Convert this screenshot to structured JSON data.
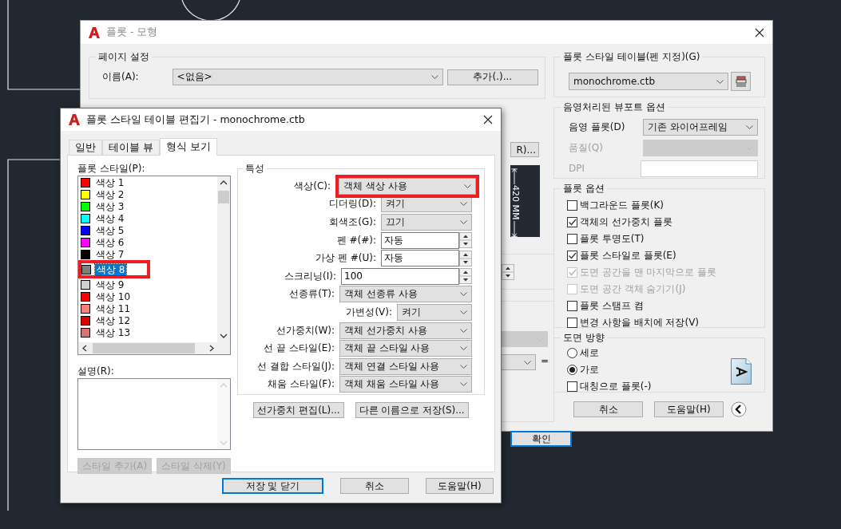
{
  "plot_dialog": {
    "title": "플롯 - 모형",
    "page_setup": {
      "title": "페이지 설정",
      "name_label": "이름(A):",
      "name_value": "<없음>",
      "add_button": "추가(.)..."
    },
    "covered": {
      "properties_button": "R)...",
      "paper_size": "420 MM",
      "equals": "=",
      "confirm_button": {
        "label": "확인",
        "default": true
      }
    },
    "plot_style_table": {
      "title": "플롯 스타일 테이블(펜 지정)(G)",
      "value": "monochrome.ctb"
    },
    "shaded_viewport": {
      "title": "음영처리된 뷰포트 옵션",
      "fields": [
        {
          "label": "음영 플롯(D)",
          "value": "기존 와이어프레임",
          "kind": "select",
          "disabled": false
        },
        {
          "label": "품질(Q)",
          "kind": "select",
          "disabled": true
        },
        {
          "label": "DPI",
          "kind": "input",
          "disabled": true
        }
      ]
    },
    "plot_options": {
      "title": "플롯 옵션",
      "items": [
        {
          "label": "백그라운드 플롯(K)",
          "checked": false,
          "disabled": false
        },
        {
          "label": "객체의 선가중치 플롯",
          "checked": true,
          "disabled": false
        },
        {
          "label": "플롯 투명도(T)",
          "checked": false,
          "disabled": false
        },
        {
          "label": "플롯 스타일로 플롯(E)",
          "checked": true,
          "disabled": false
        },
        {
          "label": "도면 공간을 맨 마지막으로 플롯",
          "checked": true,
          "disabled": true
        },
        {
          "label": "도면 공간 객체 숨기기(J)",
          "checked": false,
          "disabled": true
        },
        {
          "label": "플롯 스탬프 켬",
          "checked": false,
          "disabled": false
        },
        {
          "label": "변경 사항을 배치에 저장(V)",
          "checked": false,
          "disabled": false
        }
      ]
    },
    "orientation": {
      "title": "도면 방향",
      "options": [
        {
          "label": "세로",
          "selected": false
        },
        {
          "label": "가로",
          "selected": true
        }
      ],
      "mirror": {
        "label": "대칭으로 플롯(-)",
        "checked": false
      }
    },
    "buttons": [
      {
        "label": "취소",
        "default": false
      },
      {
        "label": "도움말(H)",
        "default": false
      }
    ]
  },
  "editor": {
    "title": "플롯 스타일 테이블 편집기 - monochrome.ctb",
    "tabs": [
      {
        "label": "일반",
        "selected": false
      },
      {
        "label": "테이블 뷰",
        "selected": false
      },
      {
        "label": "형식 보기",
        "selected": true
      }
    ],
    "styles_label": "플롯 스타일(P):",
    "styles": [
      {
        "label": "색상 1",
        "color": "#ff0000",
        "selected": false
      },
      {
        "label": "색상 2",
        "color": "#ffff00",
        "selected": false
      },
      {
        "label": "색상 3",
        "color": "#00ff00",
        "selected": false
      },
      {
        "label": "색상 4",
        "color": "#00ffff",
        "selected": false
      },
      {
        "label": "색상 5",
        "color": "#0000ff",
        "selected": false
      },
      {
        "label": "색상 6",
        "color": "#ff00ff",
        "selected": false
      },
      {
        "label": "색상 7",
        "color": "#000000",
        "selected": false,
        "highlighted": false
      },
      {
        "label": "색상 8",
        "color": "#808080",
        "selected": true,
        "highlighted": true
      },
      {
        "label": "색상 9",
        "color": "#d0d0d0",
        "selected": false
      },
      {
        "label": "색상 10",
        "color": "#ff0000",
        "selected": false
      },
      {
        "label": "색상 11",
        "color": "#ff7f7f",
        "selected": false
      },
      {
        "label": "색상 12",
        "color": "#dd0000",
        "selected": false
      },
      {
        "label": "색상 13",
        "color": "#dd7070",
        "selected": false
      }
    ],
    "description_label": "설명(R):",
    "style_buttons": [
      {
        "label": "스타일 추가(A)",
        "disabled": true
      },
      {
        "label": "스타일 삭제(Y)",
        "disabled": true
      }
    ],
    "properties": {
      "title": "특성",
      "rows": [
        {
          "label": "색상(C):",
          "value": "객체 색상 사용",
          "kind": "select",
          "highlighted": true
        },
        {
          "label": "디더링(D):",
          "value": "켜기",
          "kind": "select",
          "highlighted": false
        },
        {
          "label": "회색조(G):",
          "value": "끄기",
          "kind": "select"
        },
        {
          "label": "펜 #(#):",
          "value": "자동",
          "kind": "spin"
        },
        {
          "label": "가상 펜 #(U):",
          "value": "자동",
          "kind": "spin"
        },
        {
          "label": "스크리닝(I):",
          "value": "100",
          "kind": "spin"
        },
        {
          "label": "선종류(T):",
          "value": "객체 선종류 사용",
          "kind": "select"
        },
        {
          "label": "가변성(V):",
          "value": "켜기",
          "kind": "select"
        },
        {
          "label": "선가중치(W):",
          "value": "객체 선가중치 사용",
          "kind": "select"
        },
        {
          "label": "선 끝 스타일(E):",
          "value": "객체 끝 스타일 사용",
          "kind": "select"
        },
        {
          "label": "선 결합 스타일(J):",
          "value": "객체 연결 스타일 사용",
          "kind": "select"
        },
        {
          "label": "채움 스타일(F):",
          "value": "객체 채움 스타일 사용",
          "kind": "select"
        }
      ]
    },
    "property_buttons": [
      "선가중치 편집(L)...",
      "다른 이름으로 저장(S)..."
    ],
    "buttons": [
      {
        "label": "저장 및 닫기",
        "default": true
      },
      {
        "label": "취소",
        "default": false
      },
      {
        "label": "도움말(H)",
        "default": false
      }
    ]
  }
}
